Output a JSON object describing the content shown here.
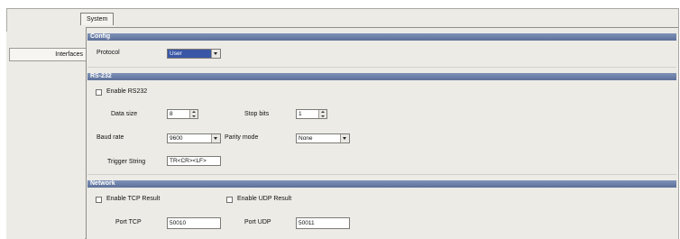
{
  "tabs": {
    "system": "System"
  },
  "left_nav": {
    "interfaces": "Interfaces"
  },
  "config": {
    "title": "Config",
    "protocol_label": "Protocol",
    "protocol_value": "User"
  },
  "rs232": {
    "title": "RS-232",
    "enable_label": "Enable RS232",
    "data_size_label": "Data size",
    "data_size_value": "8",
    "stop_bits_label": "Stop bits",
    "stop_bits_value": "1",
    "baud_rate_label": "Baud rate",
    "baud_rate_value": "9600",
    "parity_mode_label": "Parity mode",
    "parity_mode_value": "None",
    "trigger_string_label": "Trigger String",
    "trigger_string_value": "TR<CR><LF>"
  },
  "network": {
    "title": "Network",
    "enable_tcp_label": "Enable TCP Result",
    "enable_udp_label": "Enable UDP Result",
    "port_tcp_label": "Port TCP",
    "port_tcp_value": "50010",
    "port_udp_label": "Port UDP",
    "port_udp_value": "50011"
  },
  "colors": {
    "section_header": "#5d7099",
    "selected_dropdown": "#3a57a6"
  }
}
